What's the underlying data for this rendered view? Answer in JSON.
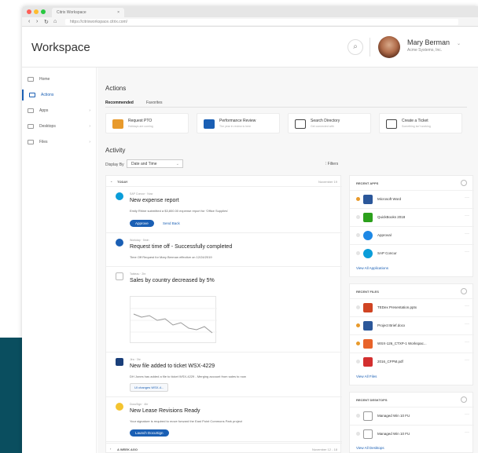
{
  "browser": {
    "tab_title": "Citrix Workspace",
    "tab_close": "×",
    "url": "https://citrixworkspace.citrix.com/"
  },
  "header": {
    "app_title": "Workspace",
    "user_name": "Mary Berman",
    "user_org": "Acme Systems, Inc."
  },
  "sidebar": {
    "items": [
      {
        "label": "Home",
        "icon": "home-icon"
      },
      {
        "label": "Actions",
        "icon": "actions-icon"
      },
      {
        "label": "Apps",
        "icon": "apps-icon"
      },
      {
        "label": "Desktops",
        "icon": "desktops-icon"
      },
      {
        "label": "Files",
        "icon": "files-icon"
      }
    ]
  },
  "actions": {
    "title": "Actions",
    "tabs": [
      "Recommended",
      "Favorites"
    ],
    "cards": [
      {
        "title": "Request PTO",
        "sub": "Holidays are coming",
        "color": "#e89a2c"
      },
      {
        "title": "Performance Review",
        "sub": "The year in review is here",
        "color": "#1a5fb4"
      },
      {
        "title": "Search Directory",
        "sub": "Get connected with",
        "color": "#444444"
      },
      {
        "title": "Create a Ticket",
        "sub": "Something isn't working",
        "color": "#444444"
      }
    ]
  },
  "activity": {
    "title": "Activity",
    "display_by_label": "Display By",
    "display_by_value": "Date and Time",
    "filters_label": "Filters",
    "group_today": "TODAY",
    "group_today_date": "November 19",
    "group_week": "A WEEK AGO",
    "group_week_date": "November 12 - 18",
    "items": [
      {
        "meta": "SAP Concur · Now",
        "title": "New expense report",
        "desc": "Emily Rhine submitted a $3,800.00 expense report for 'Office Supplies'",
        "btn_primary": "Approve",
        "btn_link": "Send Back"
      },
      {
        "meta": "Workday · 5min",
        "title": "Request time off - Successfully completed",
        "desc": "Time Off Request for Mary Berman effective on 12/24/2019"
      },
      {
        "meta": "Tableau · 2hr",
        "title": "Sales by country decreased by 5%"
      },
      {
        "meta": "Jira · 3hr",
        "title": "New file added to ticket WSX-4229",
        "desc": "DH Jones has added a file to ticket WSX-4229 - Merging account from sales to now",
        "chip": "UI changes WSX-4..."
      },
      {
        "meta": "DocuSign · 4hr",
        "title": "New Lease Revisions Ready",
        "desc": "Your signature is required to move forward the East Point Commons Park project",
        "btn_primary": "Launch DocuSign"
      }
    ]
  },
  "recent_apps": {
    "title": "RECENT APPS",
    "items": [
      {
        "name": "Microsoft Word",
        "color": "#2b579a",
        "fav": true
      },
      {
        "name": "QuickBooks 2018",
        "color": "#2ca01c",
        "fav": false
      },
      {
        "name": "Approval",
        "color": "#1e88e5",
        "fav": false
      },
      {
        "name": "SAP Concur",
        "color": "#0a9dd9",
        "fav": false
      }
    ],
    "link": "View All Applications"
  },
  "recent_files": {
    "title": "RECENT FILES",
    "items": [
      {
        "name": "TEDex Presentation.pptx",
        "color": "#d04423",
        "fav": false
      },
      {
        "name": "Project Brief.docx",
        "color": "#2b579a",
        "fav": true
      },
      {
        "name": "WSX-126_CTXP-1 Workspac...",
        "color": "#e8632a",
        "fav": true
      },
      {
        "name": "2016_CFPM.pdf",
        "color": "#d32f2f",
        "fav": false
      }
    ],
    "link": "View All Files"
  },
  "recent_desktops": {
    "title": "RECENT DESKTOPS",
    "items": [
      {
        "name": "Managed Win 10 FU",
        "fav": false
      },
      {
        "name": "Managed Win 10 FU",
        "fav": false
      }
    ],
    "link": "View All Desktops"
  },
  "brand": "citrix"
}
